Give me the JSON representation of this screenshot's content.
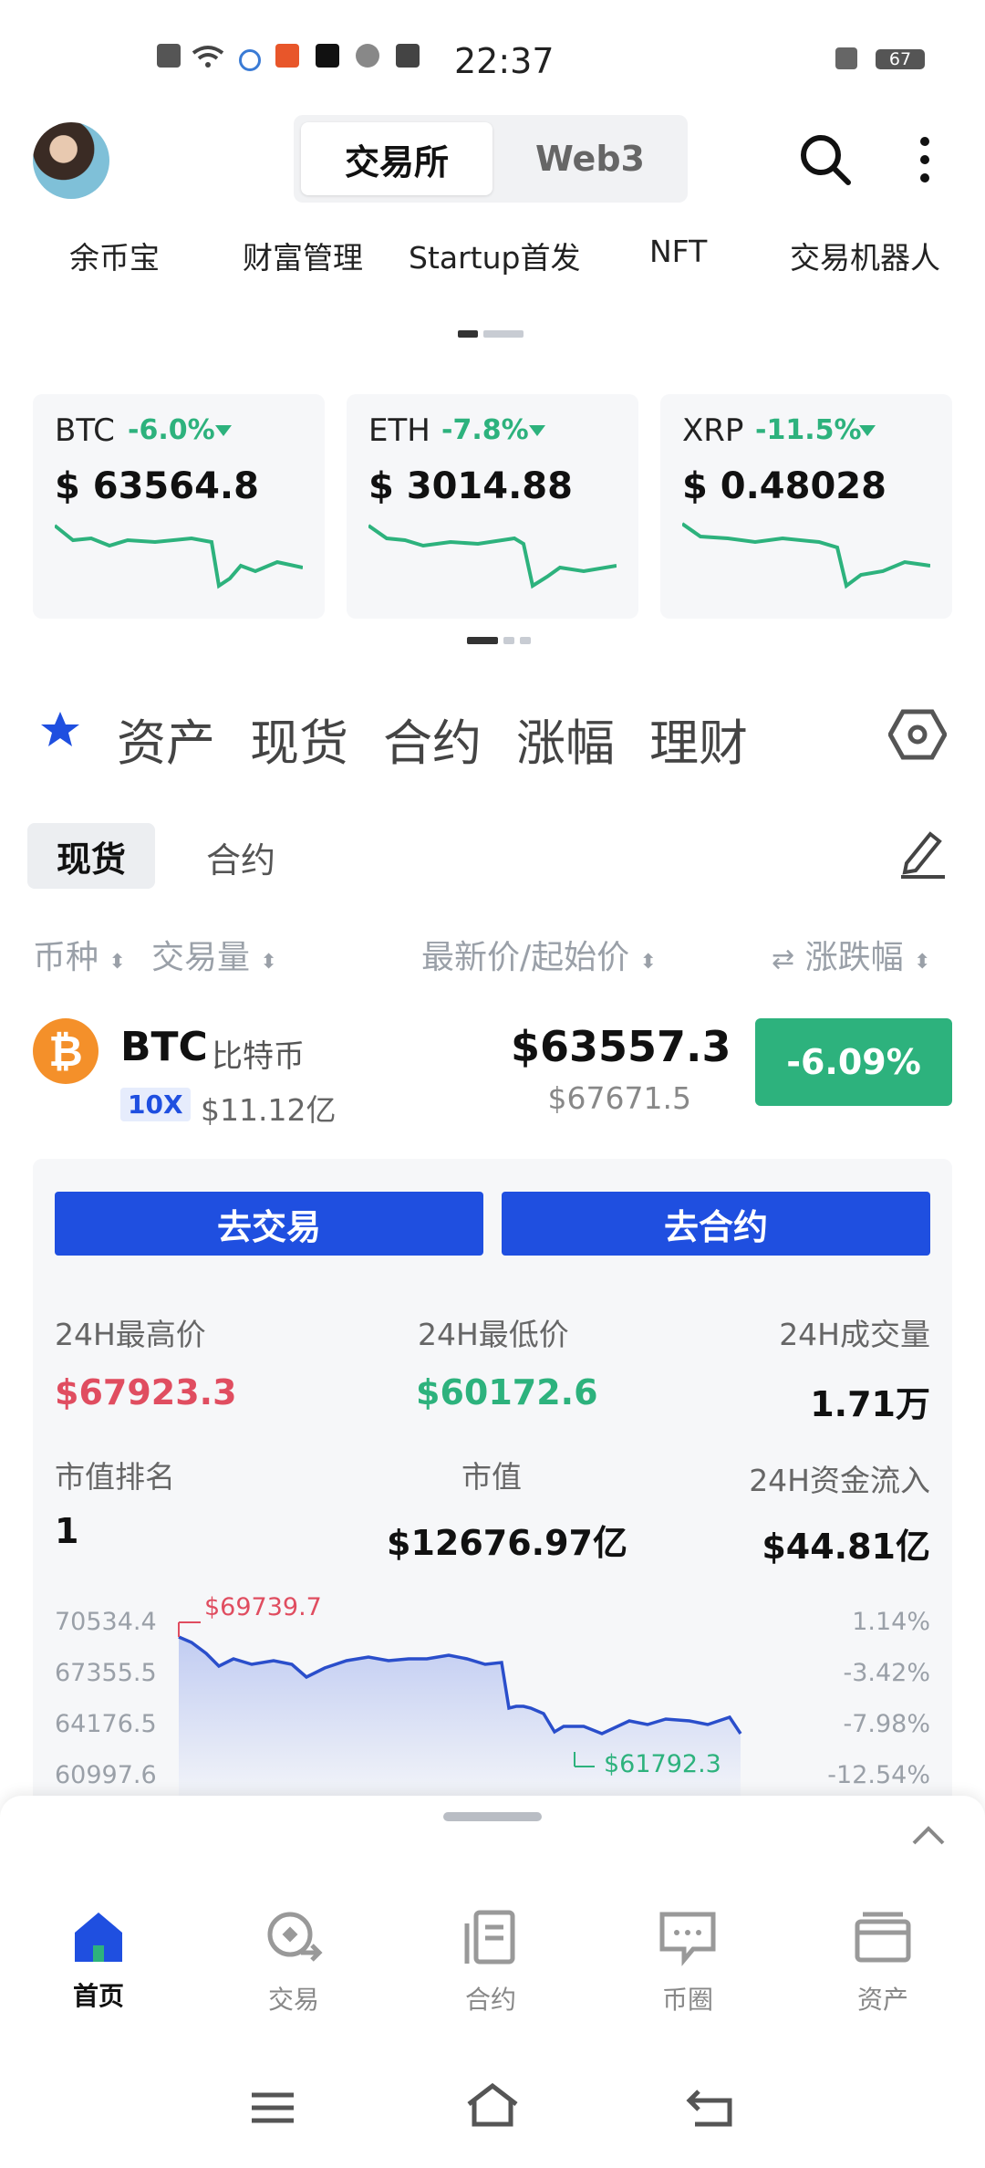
{
  "status_bar": {
    "time": "22:37",
    "battery": "67"
  },
  "header": {
    "tabs": [
      "交易所",
      "Web3"
    ]
  },
  "quick_links": [
    "余币宝",
    "财富管理",
    "Startup首发",
    "NFT",
    "交易机器人"
  ],
  "tickers": [
    {
      "symbol": "BTC",
      "change": "-6.0%",
      "price": "$ 63564.8"
    },
    {
      "symbol": "ETH",
      "change": "-7.8%",
      "price": "$ 3014.88"
    },
    {
      "symbol": "XRP",
      "change": "-11.5%",
      "price": "$ 0.48028"
    }
  ],
  "categories": [
    "资产",
    "现货",
    "合约",
    "涨幅",
    "理财"
  ],
  "subtabs": {
    "active": "现货",
    "other": "合约"
  },
  "columns": {
    "coin": "币种",
    "volume": "交易量",
    "price": "最新价/起始价",
    "change": "涨跌幅"
  },
  "coin_row": {
    "symbol": "BTC",
    "name": "比特币",
    "leverage": "10X",
    "volume": "$11.12亿",
    "last_price": "$63557.3",
    "open_price": "$67671.5",
    "change": "-6.09%"
  },
  "detail": {
    "trade_button": "去交易",
    "contract_button": "去合约",
    "stats": [
      {
        "label": "24H最高价",
        "value": "$67923.3"
      },
      {
        "label": "24H最低价",
        "value": "$60172.6"
      },
      {
        "label": "24H成交量",
        "value": "1.71万"
      },
      {
        "label": "市值排名",
        "value": "1"
      },
      {
        "label": "市值",
        "value": "$12676.97亿"
      },
      {
        "label": "24H资金流入",
        "value": "$44.81亿"
      }
    ],
    "chart_left_labels": [
      "70534.4",
      "67355.5",
      "64176.5",
      "60997.6"
    ],
    "chart_right_labels": [
      "1.14%",
      "-3.42%",
      "-7.98%",
      "-12.54%"
    ],
    "chart_high_marker": "$69739.7",
    "chart_low_marker": "$61792.3"
  },
  "bottom_nav": [
    "首页",
    "交易",
    "合约",
    "币圈",
    "资产"
  ],
  "colors": {
    "up": "#2db27d",
    "down": "#e04d60",
    "brand": "#1f4fe0"
  }
}
